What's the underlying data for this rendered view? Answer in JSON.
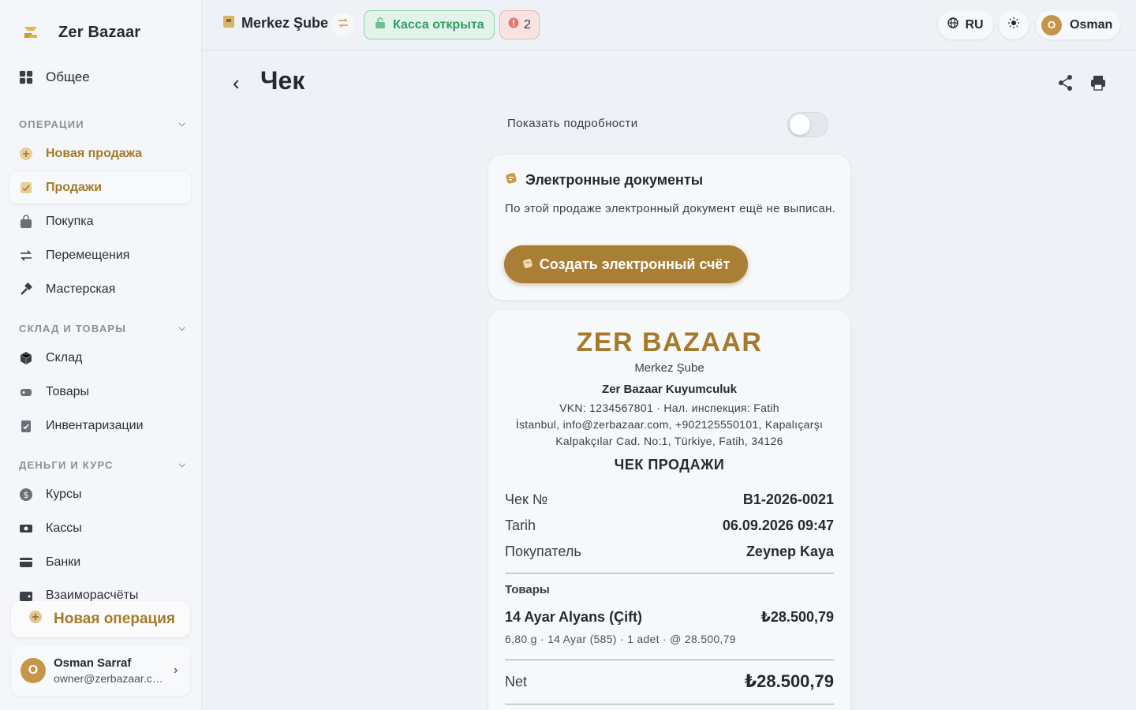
{
  "app": {
    "name": "Zer Bazaar"
  },
  "sidebar": {
    "general": "Общее",
    "sections": [
      {
        "title": "ОПЕРАЦИИ"
      },
      {
        "title": "СКЛАД И ТОВАРЫ"
      },
      {
        "title": "ДЕНЬГИ И КУРС"
      }
    ],
    "items": [
      {
        "label": "Новая продажа"
      },
      {
        "label": "Продажи"
      },
      {
        "label": "Покупка"
      },
      {
        "label": "Перемещения"
      },
      {
        "label": "Мастерская"
      },
      {
        "label": "Склад"
      },
      {
        "label": "Товары"
      },
      {
        "label": "Инвентаризации"
      },
      {
        "label": "Курсы"
      },
      {
        "label": "Кассы"
      },
      {
        "label": "Банки"
      },
      {
        "label": "Взаиморасчёты"
      }
    ],
    "new_operation": "Новая операция",
    "user": {
      "initial": "O",
      "name": "Osman Sarraf",
      "email": "owner@zerbazaar.com"
    }
  },
  "topbar": {
    "branch": "Merkez Şube",
    "cash_status": "Касса открыта",
    "alerts_count": "2",
    "language": "RU",
    "profile_initial": "O",
    "profile_name": "Osman"
  },
  "page": {
    "title": "Чек",
    "show_details_label": "Показать подробности",
    "show_details_on": false
  },
  "edocs": {
    "title": "Электронные документы",
    "text": "По этой продаже электронный документ ещё не выписан.",
    "button": "Создать электронный счёт"
  },
  "receipt": {
    "brand": "ZER BAZAAR",
    "branch": "Merkez Şube",
    "company": "Zer Bazaar Kuyumculuk",
    "tax_line": "VKN: 1234567801 · Нал. инспекция: Fatih",
    "contact_line": "İstanbul, info@zerbazaar.com, +902125550101, Kapalıçarşı",
    "address_line": "Kalpakçılar Cad. No:1, Türkiye, Fatih, 34126",
    "doc_type": "ЧЕК ПРОДАЖИ",
    "rows": [
      {
        "label": "Чек №",
        "value": "B1-2026-0021"
      },
      {
        "label": "Tarih",
        "value": "06.09.2026 09:47"
      },
      {
        "label": "Покупатель",
        "value": "Zeynep Kaya"
      }
    ],
    "items_title": "Товары",
    "items": [
      {
        "name": "14 Ayar Alyans (Çift)",
        "price": "₺28.500,79",
        "meta": "6,80 g · 14 Ayar (585) · 1 adet  ·  @ 28.500,79"
      }
    ],
    "net_label": "Net",
    "net_value": "₺28.500,79"
  },
  "colors": {
    "accent": "#a97e35",
    "success": "#2f9c63",
    "danger": "#d9534f"
  }
}
